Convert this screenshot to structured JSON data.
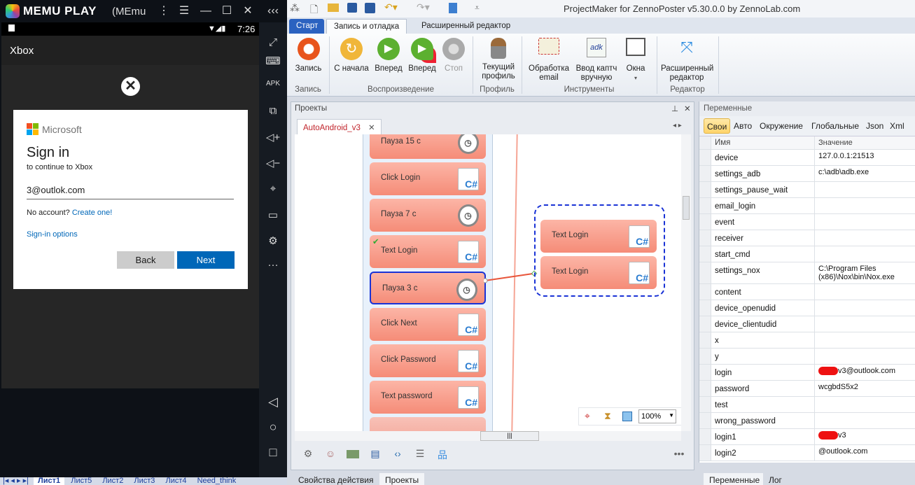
{
  "emulator": {
    "brand": "MEMU PLAY",
    "title_suffix": "(MEmu",
    "time": "7:26",
    "app_title": "Xbox",
    "signin": {
      "ms_label": "Microsoft",
      "heading": "Sign in",
      "subtitle": "to continue to Xbox",
      "email_value": "3@outlok.com",
      "no_account": "No account?",
      "create_link": "Create one!",
      "options_link": "Sign-in options",
      "back": "Back",
      "next": "Next"
    },
    "sheet_tabs": [
      "Лист1",
      "Лист5",
      "Лист2",
      "Лист3",
      "Лист4",
      "Need_think"
    ]
  },
  "app": {
    "title": "ProjectMaker for ZennoPoster v5.30.0.0 by ZennoLab.com",
    "ribbon_tabs": [
      "Старт",
      "Запись и отладка",
      "Расширенный редактор"
    ],
    "ribbon_buttons": {
      "record": "Запись",
      "from_start": "С начала",
      "forward": "Вперед",
      "forward2": "Вперед",
      "stop": "Стоп",
      "profile": "Текущий профиль",
      "email": "Обработка email",
      "captcha": "Ввод каптч вручную",
      "windows": "Окна",
      "adv_editor": "Расширенный редактор"
    },
    "ribbon_groups": {
      "record": "Запись",
      "playback": "Воспроизведение",
      "profile": "Профиль",
      "tools": "Инструменты",
      "editor": "Редактор"
    }
  },
  "projects": {
    "title": "Проекты",
    "doc_tab": "AutoAndroid_v3",
    "zoom": "100%",
    "blocks": [
      {
        "label": "Пауза 15 с",
        "icon": "timer"
      },
      {
        "label": "Click Login",
        "icon": "csharp"
      },
      {
        "label": "Пауза 7 с",
        "icon": "timer"
      },
      {
        "label": "Text Login",
        "icon": "csharp"
      },
      {
        "label": "Пауза 3 с",
        "icon": "timer"
      },
      {
        "label": "Click Next",
        "icon": "csharp"
      },
      {
        "label": "Click Password",
        "icon": "csharp"
      },
      {
        "label": "Text password",
        "icon": "csharp"
      }
    ],
    "group_blocks": [
      {
        "label": "Text Login"
      },
      {
        "label": "Text Login"
      }
    ]
  },
  "bottom_tabs": {
    "left": [
      "Свойства действия",
      "Проекты"
    ],
    "right": [
      "Переменные",
      "Лог"
    ]
  },
  "variables": {
    "title": "Переменные",
    "tabs": [
      "Свои",
      "Авто",
      "Окружение",
      "Глобальные",
      "Json",
      "Xml"
    ],
    "col_name": "Имя",
    "col_value": "Значение",
    "rows": [
      {
        "n": "device",
        "v": "127.0.0.1:21513"
      },
      {
        "n": "settings_adb",
        "v": "c:\\adb\\adb.exe"
      },
      {
        "n": "settings_pause_wait",
        "v": ""
      },
      {
        "n": "email_login",
        "v": ""
      },
      {
        "n": "event",
        "v": ""
      },
      {
        "n": "receiver",
        "v": ""
      },
      {
        "n": "start_cmd",
        "v": ""
      },
      {
        "n": "settings_nox",
        "v": "C:\\Program Files (x86)\\Nox\\bin\\Nox.exe"
      },
      {
        "n": "content",
        "v": ""
      },
      {
        "n": "device_openudid",
        "v": ""
      },
      {
        "n": "device_clientudid",
        "v": ""
      },
      {
        "n": "x",
        "v": ""
      },
      {
        "n": "y",
        "v": ""
      },
      {
        "n": "login",
        "v": "v3@outlook.com"
      },
      {
        "n": "password",
        "v": "wcgbdS5x2"
      },
      {
        "n": "test",
        "v": ""
      },
      {
        "n": "wrong_password",
        "v": ""
      },
      {
        "n": "login1",
        "v": "v3"
      },
      {
        "n": "login2",
        "v": "@outlook.com"
      }
    ]
  }
}
